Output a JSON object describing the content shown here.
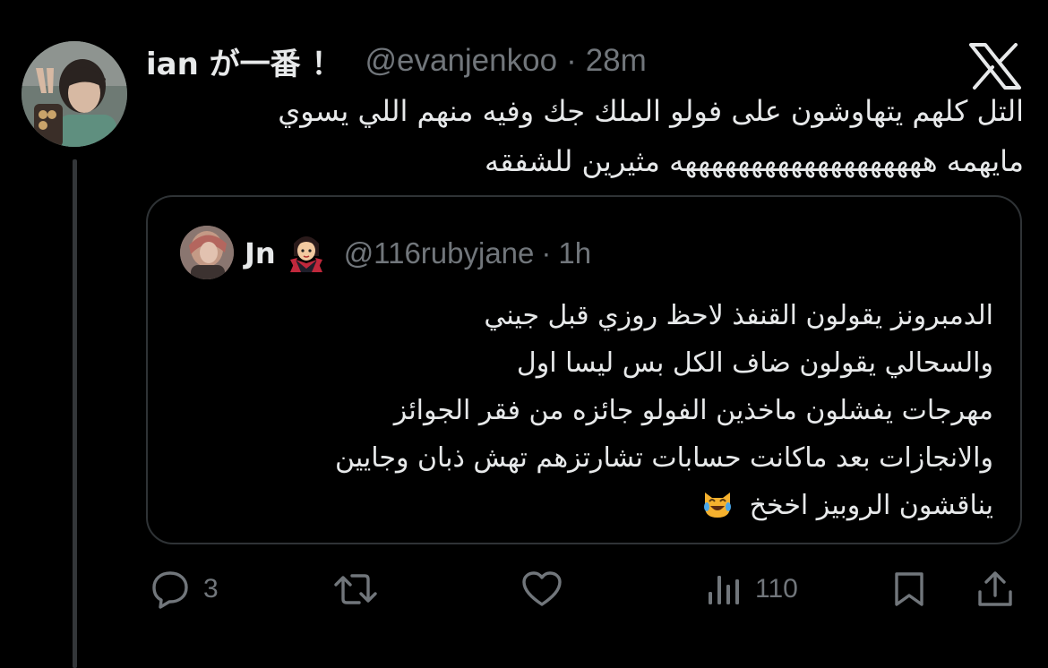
{
  "author": {
    "name": "ian が一番 ！",
    "handle": "@evanjenkoo",
    "separator": "·",
    "time": "28m"
  },
  "tweet": {
    "lines": [
      "التل كلهم يتهاوشون على فولو الملك جك وفيه منهم اللي يسوي",
      "مايهمه هههههههههههههههههههه مثيرين للشفقه"
    ]
  },
  "quote": {
    "name": "Jn",
    "handle": "@116rubyjane",
    "separator": "·",
    "time": "1h",
    "lines": [
      "الدمبرونز يقولون القنفذ لاحظ روزي قبل جيني",
      "والسحالي يقولون ضاف الكل بس ليسا اول",
      "مهرجات يفشلون ماخذين الفولو جائزه من فقر الجوائز",
      "والانجازات بعد ماكانت حسابات تشارتزهم تهش ذبان وجايين",
      "يناقشون الروبيز اخخخ"
    ]
  },
  "actions": {
    "replies": "3",
    "reposts": "",
    "likes": "",
    "views": "110"
  },
  "icons": {
    "logo": "x-logo-icon",
    "reply": "reply-icon",
    "repost": "repost-icon",
    "like": "heart-icon",
    "views": "views-icon",
    "bookmark": "bookmark-icon",
    "share": "share-icon",
    "quote_emoji": "vampire-emoji-icon",
    "laugh_emoji": "crying-laughing-cat-emoji-icon"
  },
  "colors": {
    "background": "#000000",
    "text": "#e7e9ea",
    "muted": "#71767b",
    "border": "#2f3336"
  }
}
